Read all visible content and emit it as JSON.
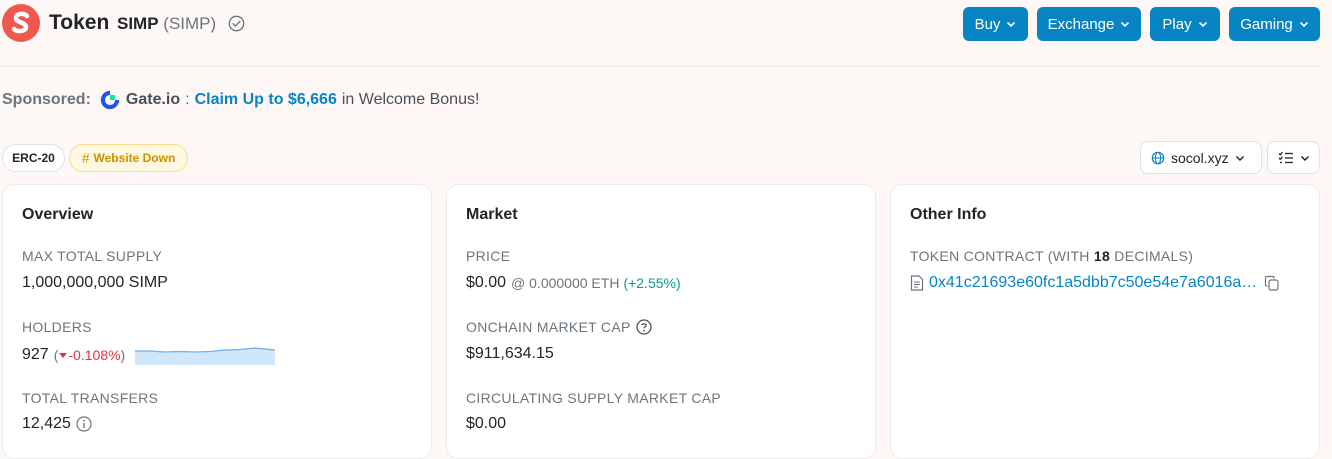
{
  "header": {
    "title": "Token",
    "symbol": "SIMP",
    "symbol_paren": "(SIMP)",
    "buttons": [
      {
        "label": "Buy"
      },
      {
        "label": "Exchange"
      },
      {
        "label": "Play"
      },
      {
        "label": "Gaming"
      }
    ]
  },
  "sponsored": {
    "label": "Sponsored:",
    "brand": "Gate.io",
    "separator": ":",
    "claim": "Claim Up to $6,666",
    "rest": "in Welcome Bonus!"
  },
  "badges": {
    "standard": "ERC-20",
    "website_status": "Website Down"
  },
  "toolbar": {
    "site_label": "socol.xyz"
  },
  "overview": {
    "title": "Overview",
    "max_supply_label": "MAX TOTAL SUPPLY",
    "max_supply_value": "1,000,000,000 SIMP",
    "holders_label": "HOLDERS",
    "holders_value": "927",
    "holders_change": "-0.108%",
    "transfers_label": "TOTAL TRANSFERS",
    "transfers_value": "12,425"
  },
  "market": {
    "title": "Market",
    "price_label": "PRICE",
    "price_value": "$0.00",
    "price_eth": "@ 0.000000 ETH",
    "price_change": "(+2.55%)",
    "onchain_label": "ONCHAIN MARKET CAP",
    "onchain_value": "$911,634.15",
    "circ_label": "CIRCULATING SUPPLY MARKET CAP",
    "circ_value": "$0.00"
  },
  "other": {
    "title": "Other Info",
    "contract_label_pre": "TOKEN CONTRACT (WITH",
    "contract_decimals": "18",
    "contract_label_post": "DECIMALS)",
    "contract_address": "0x41c21693e60fc1a5dbb7c50e54e7a6016a…"
  },
  "colors": {
    "primary": "#0784c3",
    "logo": "#f0584f",
    "positive": "#00a186",
    "negative": "#dc3545",
    "warning": "#c89103"
  }
}
